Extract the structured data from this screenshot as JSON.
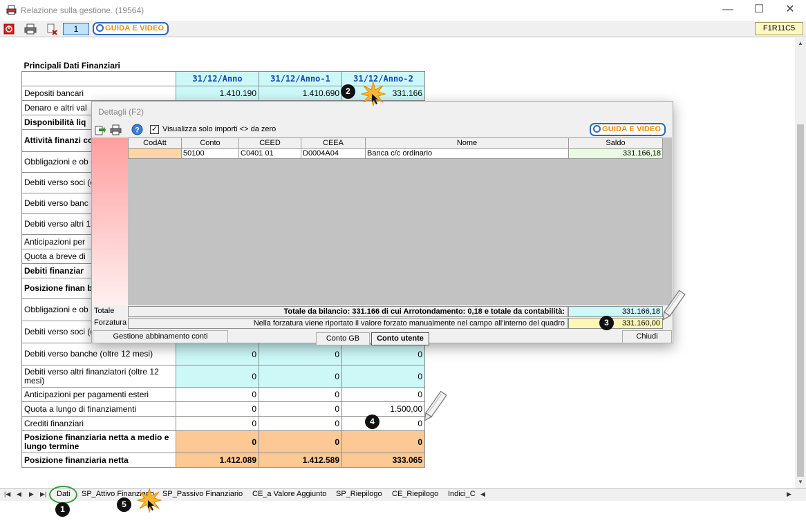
{
  "window": {
    "title": "Relazione sulla gestione. (19564)",
    "minimize": "—",
    "maximize": "☐",
    "close": "✕"
  },
  "toolbar": {
    "page_number": "1",
    "guida_label": "GUIDA E VIDEO",
    "code": "F1R11C5"
  },
  "table": {
    "title": "Principali Dati Finanziari",
    "headers": [
      "31/12/Anno",
      "31/12/Anno-1",
      "31/12/Anno-2"
    ],
    "rows": [
      {
        "label": "Depositi bancari",
        "v": [
          "1.410.190",
          "1.410.690",
          "331.166"
        ]
      },
      {
        "label": "Denaro e altri val",
        "v": [
          "",
          "",
          ""
        ]
      },
      {
        "label": "Disponibilità liq",
        "v": [
          "",
          "",
          ""
        ]
      },
      {
        "label": "Attività finanzi costituiscono im",
        "v": [
          "",
          "",
          ""
        ]
      },
      {
        "label": "Obbligazioni e ob (entro 12 mesi)",
        "v": [
          "",
          "",
          ""
        ]
      },
      {
        "label": "Debiti verso soci (entro 12 mesi)",
        "v": [
          "",
          "",
          ""
        ]
      },
      {
        "label": "Debiti verso banc",
        "v": [
          "",
          "",
          ""
        ]
      },
      {
        "label": "Debiti verso altri 12 mesi)",
        "v": [
          "",
          "",
          ""
        ]
      },
      {
        "label": "Anticipazioni per",
        "v": [
          "",
          "",
          ""
        ]
      },
      {
        "label": "Quota a breve di",
        "v": [
          "",
          "",
          ""
        ]
      },
      {
        "label": "Debiti finanziar",
        "v": [
          "",
          "",
          ""
        ]
      },
      {
        "label": "Posizione finan breve termine",
        "v": [
          "",
          "",
          ""
        ]
      },
      {
        "label": "Obbligazioni e ob (oltre 12 mesi)",
        "v": [
          "",
          "",
          ""
        ]
      },
      {
        "label": "Debiti verso soci (oltre 12 mesi)",
        "v": [
          "0",
          "0",
          "0"
        ]
      },
      {
        "label": "Debiti verso banche (oltre 12 mesi)",
        "v": [
          "0",
          "0",
          "0"
        ]
      },
      {
        "label": "Debiti verso altri finanziatori (oltre 12 mesi)",
        "v": [
          "0",
          "0",
          "0"
        ]
      },
      {
        "label": "Anticipazioni per pagamenti esteri",
        "v": [
          "0",
          "0",
          "0"
        ]
      },
      {
        "label": "Quota a lungo di finanziamenti",
        "v": [
          "0",
          "0",
          "1.500,00"
        ]
      },
      {
        "label": "Crediti finanziari",
        "v": [
          "0",
          "0",
          "0"
        ]
      },
      {
        "label": "Posizione finanziaria netta a medio e lungo termine",
        "v": [
          "0",
          "0",
          "0"
        ]
      },
      {
        "label": "Posizione finanziaria netta",
        "v": [
          "1.412.089",
          "1.412.589",
          "333.065"
        ]
      }
    ]
  },
  "dialog": {
    "title": "Dettagli (F2)",
    "checkbox_label": "Visualizza solo importi <> da zero",
    "guida_label": "GUIDA E VIDEO",
    "columns": [
      "CodAtt",
      "Conto",
      "CEED",
      "CEEA",
      "Nome",
      "Saldo"
    ],
    "rows": [
      {
        "codatt": "",
        "conto": "50100",
        "ceed": "C0401 01",
        "ceea": "D0004A04",
        "nome": "Banca c/c ordinario",
        "saldo": "331.166,18"
      }
    ],
    "totale_label": "Totale",
    "forzatura_label": "Forzatura",
    "totale_text": "Totale da bilancio: 331.166 di cui Arrotondamento: 0,18 e totale da contabilità:",
    "totale_value": "331.166,18",
    "forzatura_text": "Nella forzatura viene riportato il valore forzato manualmente nel campo all'interno del quadro",
    "forzatura_value": "331.160,00",
    "btn_gestione": "Gestione abbinamento conti",
    "btn_conto_gb": "Conto GB",
    "btn_conto_utente": "Conto utente",
    "btn_chiudi": "Chiudi"
  },
  "sheets": {
    "tabs": [
      "Dati",
      "SP_Attivo Finanziario",
      "SP_Passivo Finanziario",
      "CE_a Valore Aggiunto",
      "SP_Riepilogo",
      "CE_Riepilogo",
      "Indici_C"
    ]
  },
  "callouts": [
    "1",
    "2",
    "3",
    "4",
    "5"
  ]
}
